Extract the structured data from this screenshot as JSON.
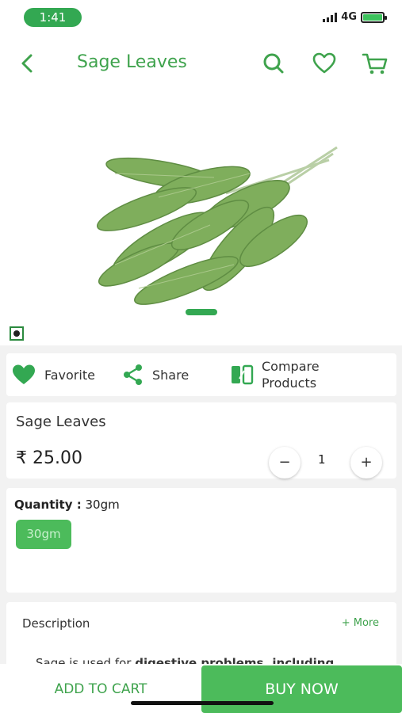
{
  "status_bar": {
    "time": "1:41",
    "network": "4G"
  },
  "header": {
    "title": "Sage Leaves"
  },
  "actions": {
    "favorite": "Favorite",
    "share": "Share",
    "compare_line1": "Compare",
    "compare_line2": "Products"
  },
  "product": {
    "name": "Sage Leaves",
    "price": "₹ 25.00",
    "quantity": "1",
    "minus": "−",
    "plus": "+"
  },
  "quantity_section": {
    "label": "Quantity :",
    "selected": "30gm",
    "options": [
      "30gm"
    ]
  },
  "description": {
    "title": "Description",
    "more": "+ More",
    "text_plain": "Sage is used for ",
    "text_bold": "digestive problems, including"
  },
  "bottom": {
    "add_to_cart": "ADD TO CART",
    "buy_now": "BUY NOW"
  },
  "colors": {
    "accent": "#3fa34d",
    "button": "#4cbb5b"
  }
}
